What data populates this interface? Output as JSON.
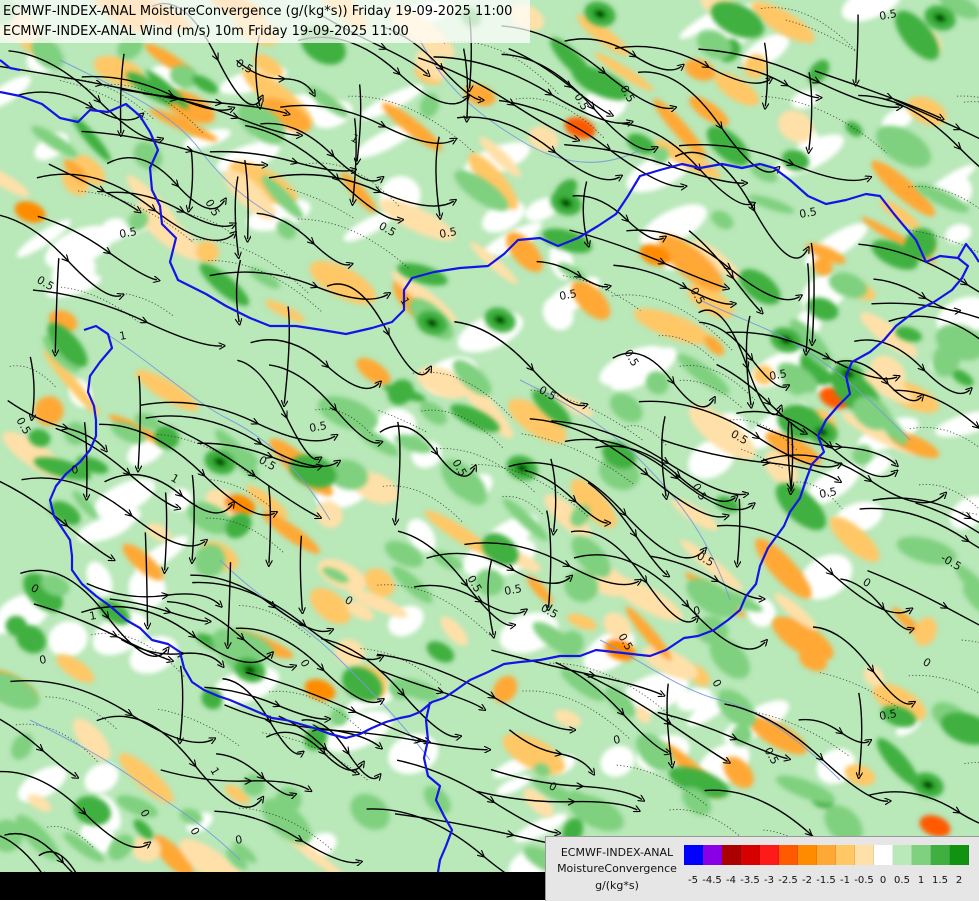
{
  "header": {
    "line1": "ECMWF-INDEX-ANAL MoistureConvergence (g/(kg*s)) Friday 19-09-2025 11:00",
    "line2": "ECMWF-INDEX-ANAL Wind (m/s) 10m Friday 19-09-2025 11:00"
  },
  "legend": {
    "line1": "ECMWF-INDEX-ANAL",
    "line2": "MoistureConvergence",
    "line3": "g/(kg*s)",
    "ticks": [
      "-5",
      "-4.5",
      "-4",
      "-3.5",
      "-3",
      "-2.5",
      "-2",
      "-1.5",
      "-1",
      "-0.5",
      "0",
      "0.5",
      "1",
      "1.5",
      "2"
    ],
    "colors": [
      "#0000ff",
      "#8a00e6",
      "#aa0000",
      "#d60000",
      "#ff1a1a",
      "#ff5a00",
      "#ff8c00",
      "#ffa836",
      "#ffc766",
      "#ffe0a8",
      "#ffffff",
      "#b9e8b9",
      "#7fd07f",
      "#3fb03f",
      "#119211"
    ]
  },
  "map": {
    "contour_labels": [
      "0.5",
      "0.5",
      "0.5",
      "0.5",
      "0.5",
      "0.5",
      "0.5",
      "0.5",
      "0.5",
      "0.5",
      "0.5",
      "0.5",
      "0.5",
      "0.5",
      "0.5",
      "0.5",
      "0.5",
      "0.5",
      "0.5",
      "0.5",
      "0.5",
      "0.5",
      "0.5",
      "0.5",
      "0.5",
      "0",
      "0",
      "0",
      "0",
      "0",
      "0",
      "0",
      "0",
      "0",
      "0",
      "0",
      "0",
      "0",
      "0",
      "1",
      "1",
      "1",
      "1",
      "1",
      "1",
      "0.5",
      "0.5",
      "-0.5",
      "0.5",
      "0.5"
    ],
    "border_color": "#1414e6",
    "river_color": "#7799dd",
    "streamline_color": "#000000"
  }
}
